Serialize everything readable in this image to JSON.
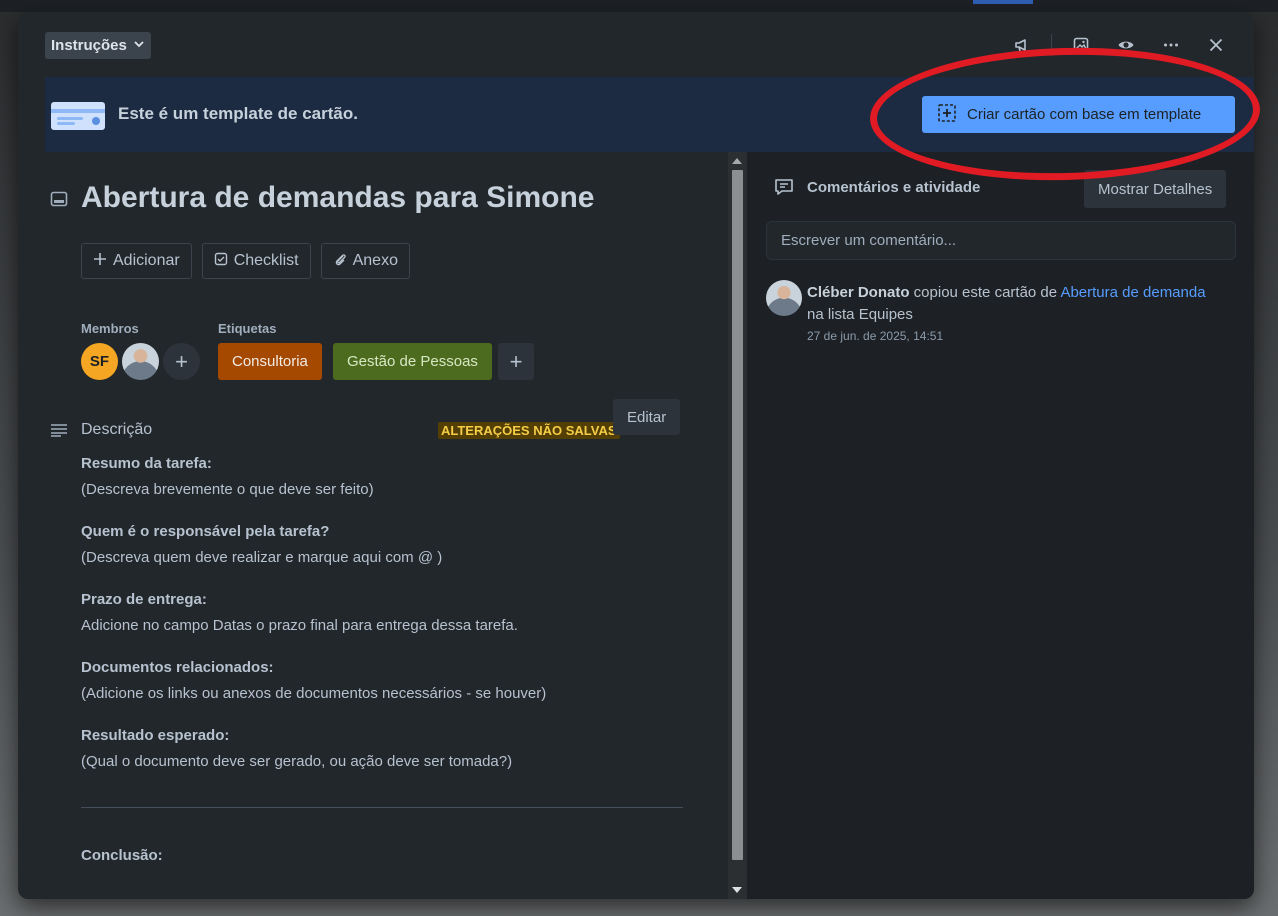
{
  "header": {
    "list_name": "Instruções",
    "icons": [
      "megaphone-icon",
      "image-icon",
      "eye-icon",
      "more-icon",
      "close-icon"
    ]
  },
  "banner": {
    "text": "Este é um template de cartão.",
    "button_label": "Criar cartão com base em template"
  },
  "card": {
    "title": "Abertura de demandas para Simone",
    "actions": [
      {
        "label": "Adicionar"
      },
      {
        "label": "Checklist"
      },
      {
        "label": "Anexo"
      }
    ],
    "members_label": "Membros",
    "member_initials": "SF",
    "labels_label": "Etiquetas",
    "labels": [
      {
        "name": "Consultoria",
        "color": "#a54800"
      },
      {
        "name": "Gestão de Pessoas",
        "color": "#4c6b1f"
      }
    ],
    "description": {
      "title": "Descrição",
      "unsaved": "ALTERAÇÕES NÃO SALVAS",
      "edit_label": "Editar",
      "blocks": [
        {
          "heading": "Resumo da tarefa:",
          "text": "(Descreva brevemente o que deve ser feito)"
        },
        {
          "heading": "Quem é o responsável pela tarefa?",
          "text": "(Descreva quem deve realizar e marque aqui com @ )"
        },
        {
          "heading": "Prazo de entrega:",
          "text": "Adicione no campo Datas o prazo final para entrega dessa tarefa."
        },
        {
          "heading": "Documentos relacionados:",
          "text": "(Adicione os links ou anexos de documentos necessários - se houver)"
        },
        {
          "heading": "Resultado esperado:",
          "text": "(Qual o documento deve ser gerado, ou ação deve ser tomada?)"
        }
      ],
      "conclusion": "Conclusão:"
    }
  },
  "activity": {
    "title": "Comentários e atividade",
    "details_label": "Mostrar Detalhes",
    "comment_placeholder": "Escrever um comentário...",
    "entry": {
      "user": "Cléber Donato",
      "action": " copiou este cartão de ",
      "link": "Abertura de demanda",
      "suffix": "na lista Equipes",
      "date": "27 de jun. de 2025, 14:51"
    }
  },
  "colors": {
    "accent": "#579dff",
    "highlight_circle": "#e01b24",
    "unsaved": "#f5cd47"
  }
}
